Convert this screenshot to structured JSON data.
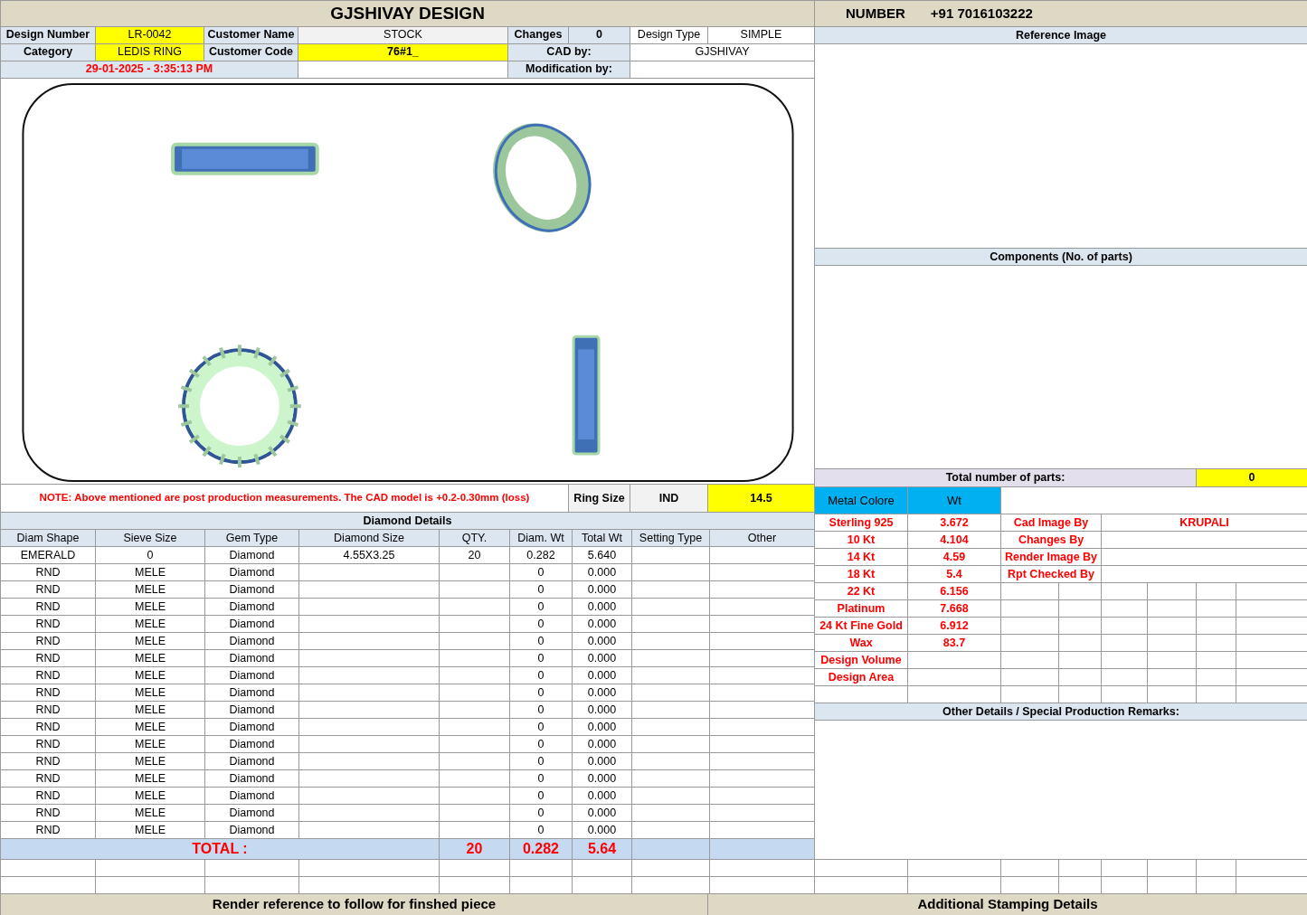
{
  "title": "GJSHIVAY DESIGN",
  "contact": {
    "label": "NUMBER",
    "value": "+91 7016103222"
  },
  "info": {
    "design_number_label": "Design Number",
    "design_number": "LR-0042",
    "customer_name_label": "Customer Name",
    "customer_name": "STOCK",
    "changes_label": "Changes",
    "changes": "0",
    "design_type_label": "Design Type",
    "design_type": "SIMPLE",
    "category_label": "Category",
    "category": "LEDIS RING",
    "customer_code_label": "Customer Code",
    "customer_code": "76#1_",
    "cad_by_label": "CAD by:",
    "cad_by": "GJSHIVAY",
    "date": "29-01-2025 - 3:35:13 PM",
    "modification_by_label": "Modification by:"
  },
  "note": "NOTE: Above mentioned are post production measurements. The CAD model is +0.2-0.30mm (loss)",
  "ring_size": {
    "label": "Ring Size",
    "standard": "IND",
    "value": "14.5"
  },
  "diamond": {
    "title": "Diamond Details",
    "columns": [
      "Diam Shape",
      "Sieve Size",
      "Gem Type",
      "Diamond Size",
      "QTY.",
      "Diam. Wt",
      "Total Wt",
      "Setting Type",
      "Other"
    ],
    "rows": [
      {
        "shape": "EMERALD",
        "sieve": "0",
        "gem": "Diamond",
        "size": "4.55X3.25",
        "qty": "20",
        "diam_wt": "0.282",
        "total_wt": "5.640"
      },
      {
        "shape": "RND",
        "sieve": "MELE",
        "gem": "Diamond",
        "diam_wt": "0",
        "total_wt": "0.000"
      },
      {
        "shape": "RND",
        "sieve": "MELE",
        "gem": "Diamond",
        "diam_wt": "0",
        "total_wt": "0.000"
      },
      {
        "shape": "RND",
        "sieve": "MELE",
        "gem": "Diamond",
        "diam_wt": "0",
        "total_wt": "0.000"
      },
      {
        "shape": "RND",
        "sieve": "MELE",
        "gem": "Diamond",
        "diam_wt": "0",
        "total_wt": "0.000"
      },
      {
        "shape": "RND",
        "sieve": "MELE",
        "gem": "Diamond",
        "diam_wt": "0",
        "total_wt": "0.000"
      },
      {
        "shape": "RND",
        "sieve": "MELE",
        "gem": "Diamond",
        "diam_wt": "0",
        "total_wt": "0.000"
      },
      {
        "shape": "RND",
        "sieve": "MELE",
        "gem": "Diamond",
        "diam_wt": "0",
        "total_wt": "0.000"
      },
      {
        "shape": "RND",
        "sieve": "MELE",
        "gem": "Diamond",
        "diam_wt": "0",
        "total_wt": "0.000"
      },
      {
        "shape": "RND",
        "sieve": "MELE",
        "gem": "Diamond",
        "diam_wt": "0",
        "total_wt": "0.000"
      },
      {
        "shape": "RND",
        "sieve": "MELE",
        "gem": "Diamond",
        "diam_wt": "0",
        "total_wt": "0.000"
      },
      {
        "shape": "RND",
        "sieve": "MELE",
        "gem": "Diamond",
        "diam_wt": "0",
        "total_wt": "0.000"
      },
      {
        "shape": "RND",
        "sieve": "MELE",
        "gem": "Diamond",
        "diam_wt": "0",
        "total_wt": "0.000"
      },
      {
        "shape": "RND",
        "sieve": "MELE",
        "gem": "Diamond",
        "diam_wt": "0",
        "total_wt": "0.000"
      },
      {
        "shape": "RND",
        "sieve": "MELE",
        "gem": "Diamond",
        "diam_wt": "0",
        "total_wt": "0.000"
      },
      {
        "shape": "RND",
        "sieve": "MELE",
        "gem": "Diamond",
        "diam_wt": "0",
        "total_wt": "0.000"
      },
      {
        "shape": "RND",
        "sieve": "MELE",
        "gem": "Diamond",
        "diam_wt": "0",
        "total_wt": "0.000"
      }
    ],
    "total": {
      "label": "TOTAL :",
      "qty": "20",
      "diam_wt": "0.282",
      "total_wt": "5.64"
    }
  },
  "reference_image": {
    "title": "Reference Image"
  },
  "components": {
    "title": "Components (No. of parts)",
    "total_label": "Total number of parts:",
    "total": "0"
  },
  "metals": {
    "columns": [
      "Metal Colore",
      "Wt"
    ],
    "rows": [
      {
        "name": "Sterling 925",
        "wt": "3.672"
      },
      {
        "name": "10 Kt",
        "wt": "4.104"
      },
      {
        "name": "14 Kt",
        "wt": "4.59"
      },
      {
        "name": "18 Kt",
        "wt": "5.4"
      },
      {
        "name": "22 Kt",
        "wt": "6.156"
      },
      {
        "name": "Platinum",
        "wt": "7.668"
      },
      {
        "name": "24 Kt Fine Gold",
        "wt": "6.912"
      },
      {
        "name": "Wax",
        "wt": "83.7"
      },
      {
        "name": "Design Volume"
      },
      {
        "name": "Design Area"
      }
    ]
  },
  "credits": [
    {
      "label": "Cad Image By",
      "value": "KRUPALI"
    },
    {
      "label": "Changes By"
    },
    {
      "label": "Render Image By"
    },
    {
      "label": "Rpt Checked By"
    }
  ],
  "remarks": {
    "title": "Other Details / Special Production Remarks:"
  },
  "footer": [
    "Render reference to follow for finshed piece",
    "Additional Stamping Details"
  ]
}
